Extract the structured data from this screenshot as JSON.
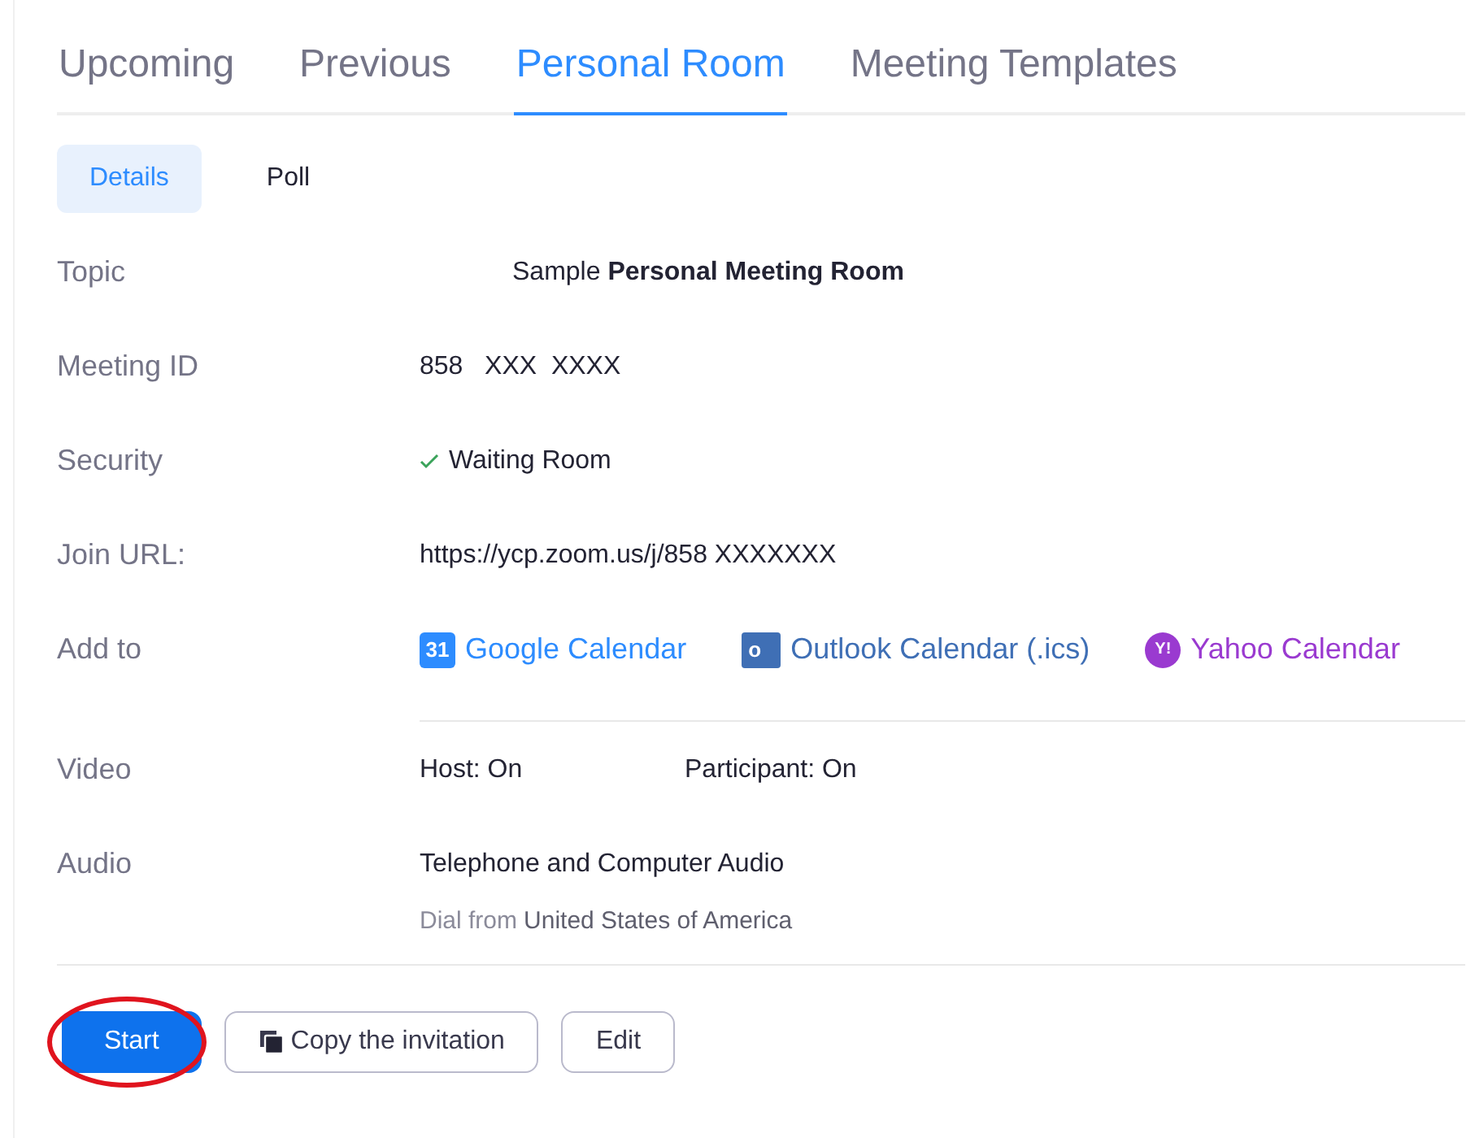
{
  "tabs": [
    {
      "label": "Upcoming",
      "selected": false
    },
    {
      "label": "Previous",
      "selected": false
    },
    {
      "label": "Personal Room",
      "selected": true
    },
    {
      "label": "Meeting Templates",
      "selected": false
    }
  ],
  "subtabs": [
    {
      "label": "Details",
      "selected": true
    },
    {
      "label": "Poll",
      "selected": false
    }
  ],
  "rows": [
    {
      "label": "Topic",
      "kind": "topic",
      "value": "Sample **Personal Meeting Room**"
    },
    {
      "label": "Meeting ID",
      "kind": "text",
      "value": "858   XXX  XXXX"
    },
    {
      "label": "Security",
      "kind": "check",
      "value": "Waiting Room"
    },
    {
      "label": "Join URL:",
      "kind": "text",
      "value": "https://ycp.zoom.us/j/858 XXXXXXX"
    },
    {
      "label": "Add to",
      "kind": "calendars",
      "items": [
        {
          "kind": "date-tile",
          "icon_text": "31",
          "text": "Google Calendar",
          "color": "#2d8cff"
        },
        {
          "kind": "envelope-tile",
          "icon_text": "o",
          "text": "Outlook Calendar (.ics)",
          "color": "#3f6fb5"
        },
        {
          "kind": "round-badge",
          "icon_text": "Y!",
          "text": "Yahoo Calendar",
          "color": "#9a3ad0"
        }
      ]
    },
    {
      "label": "Video",
      "kind": "pair",
      "values": [
        "Host: On",
        "Participant: On"
      ]
    },
    {
      "label": "Audio",
      "kind": "lines",
      "lines": [
        {
          "text": "Telephone and Computer Audio"
        },
        {
          "text": "Dial from",
          "detail": "United States of America"
        }
      ]
    }
  ],
  "buttons": [
    {
      "label": "Start",
      "kind": "primary",
      "circled": true
    },
    {
      "label": "Copy the invitation",
      "kind": "copy",
      "circled": false
    },
    {
      "label": "Edit",
      "kind": "plain",
      "circled": false
    }
  ]
}
